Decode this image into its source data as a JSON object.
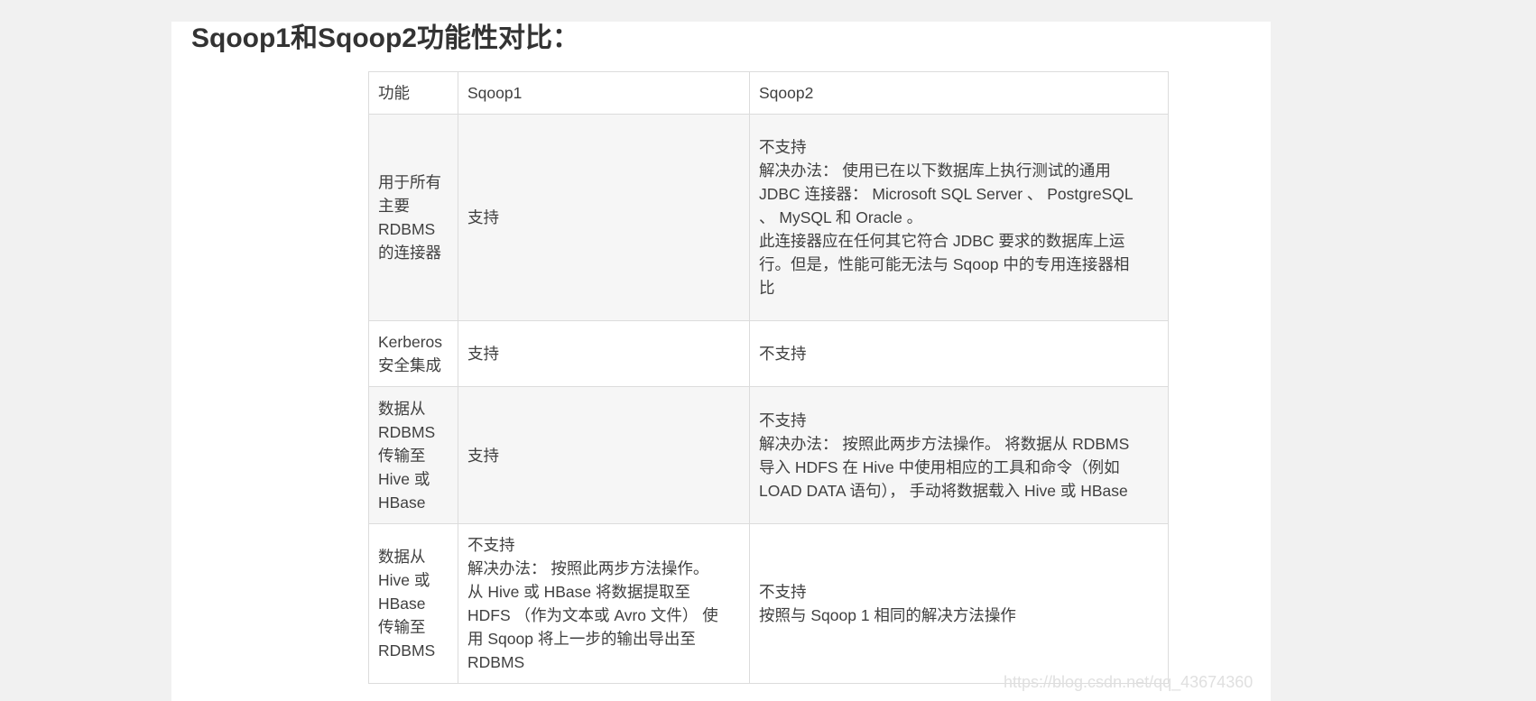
{
  "heading": "Sqoop1和Sqoop2功能性对比：",
  "table": {
    "headers": [
      "功能",
      "Sqoop1",
      "Sqoop2"
    ],
    "rows": [
      {
        "feature": [
          "用于所有",
          "主要",
          "RDBMS",
          "的连接器"
        ],
        "sqoop1": [
          "支持"
        ],
        "sqoop2": [
          "不支持",
          "解决办法： 使用已在以下数据库上执行测试的通用",
          "JDBC 连接器： Microsoft SQL Server 、 PostgreSQL",
          "、 MySQL 和 Oracle 。",
          "此连接器应在任何其它符合 JDBC 要求的数据库上运",
          "行。但是，性能可能无法与 Sqoop 中的专用连接器相",
          "比"
        ]
      },
      {
        "feature": [
          "Kerberos",
          "安全集成"
        ],
        "sqoop1": [
          "支持"
        ],
        "sqoop2": [
          "不支持"
        ]
      },
      {
        "feature": [
          "数据从",
          "RDBMS",
          "传输至",
          "Hive 或",
          "HBase"
        ],
        "sqoop1": [
          "支持"
        ],
        "sqoop2": [
          "不支持",
          "解决办法： 按照此两步方法操作。 将数据从 RDBMS",
          "导入 HDFS 在 Hive 中使用相应的工具和命令（例如",
          "LOAD DATA 语句）， 手动将数据载入 Hive 或 HBase"
        ]
      },
      {
        "feature": [
          "数据从",
          "Hive 或",
          "HBase",
          "传输至",
          "RDBMS"
        ],
        "sqoop1": [
          "不支持",
          "解决办法： 按照此两步方法操作。",
          "从 Hive 或 HBase 将数据提取至",
          "HDFS （作为文本或 Avro 文件） 使",
          "用 Sqoop 将上一步的输出导出至",
          "RDBMS"
        ],
        "sqoop2": [
          "不支持",
          "按照与 Sqoop 1 相同的解决方法操作"
        ]
      }
    ]
  },
  "watermark": "https://blog.csdn.net/qq_43674360"
}
